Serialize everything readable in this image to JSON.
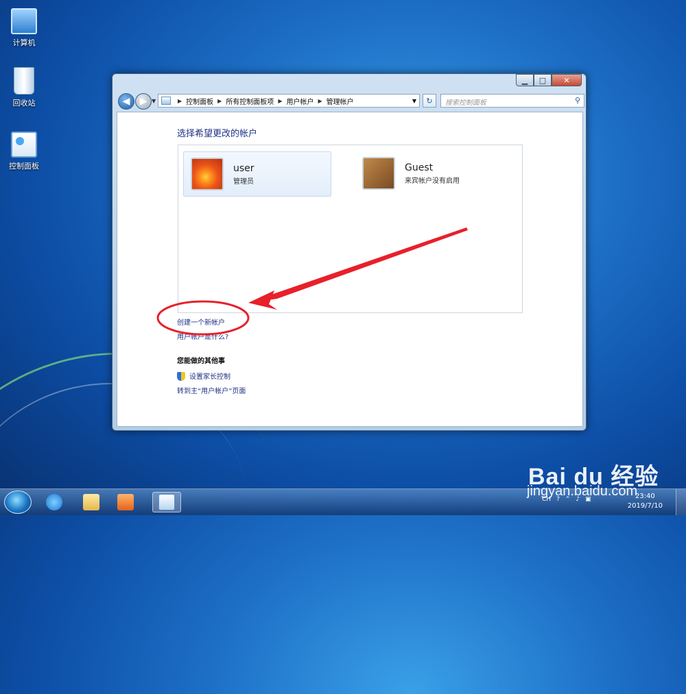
{
  "desktop": {
    "icons": [
      {
        "label": "计算机",
        "icon": "computer-icon"
      },
      {
        "label": "回收站",
        "icon": "recycle-bin-icon"
      },
      {
        "label": "控制面板",
        "icon": "control-panel-icon"
      }
    ]
  },
  "window": {
    "breadcrumb": [
      "控制面板",
      "所有控制面板项",
      "用户帐户",
      "管理帐户"
    ],
    "search_placeholder": "搜索控制面板",
    "heading": "选择希望更改的帐户",
    "accounts": [
      {
        "name": "user",
        "role": "管理员",
        "picture": "flower"
      },
      {
        "name": "Guest",
        "role": "来宾帐户没有启用",
        "picture": "briefcase"
      }
    ],
    "create_link": "创建一个新帐户",
    "what_link": "用户帐户是什么?",
    "other_heading": "您能做的其他事",
    "other_links": [
      "设置家长控制",
      "转到主“用户帐户”页面"
    ]
  },
  "taskbar": {
    "lang": "CH",
    "time": "23:40",
    "date": "2019/7/10"
  },
  "watermark": {
    "brand": "Bai du 经验",
    "url": "jingyan.baidu.com"
  },
  "annotation_color": "#e8202a",
  "accent": "#1e3287"
}
